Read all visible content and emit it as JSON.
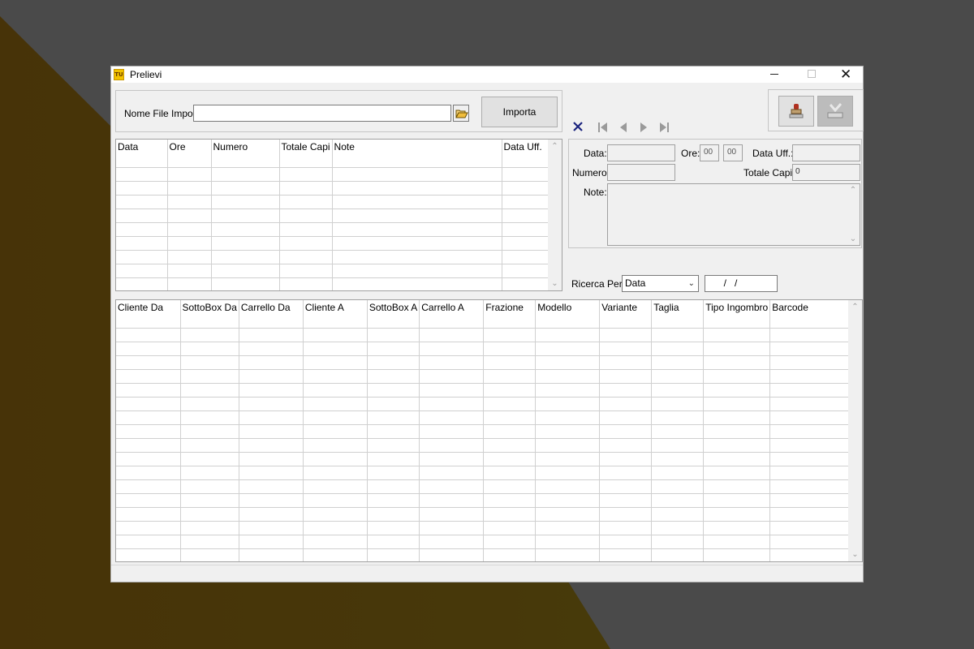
{
  "window": {
    "title": "Prelievi",
    "app_icon_text": "TU"
  },
  "import": {
    "label": "Nome File Import:",
    "value": "",
    "button_label": "Importa"
  },
  "header_table": {
    "columns": [
      "Data",
      "Ore",
      "Numero",
      "Totale Capi",
      "Note",
      "Data Uff."
    ],
    "rows": []
  },
  "detail": {
    "data_label": "Data:",
    "data_value": "",
    "ore_label": "Ore:",
    "ore_hours": "00",
    "ore_minutes": "00",
    "data_uff_label": "Data Uff.:",
    "data_uff_value": "",
    "numero_label": "Numero:",
    "numero_value": "",
    "totale_capi_label": "Totale Capi:",
    "totale_capi_value": "0",
    "note_label": "Note:",
    "note_value": ""
  },
  "search": {
    "label": "Ricerca Per:",
    "selected": "Data",
    "date_value": "  /   /"
  },
  "detail_table": {
    "columns": [
      "Cliente Da",
      "SottoBox Da",
      "Carrello Da",
      "Cliente A",
      "SottoBox A",
      "Carrello A",
      "Frazione",
      "Modello",
      "Variante",
      "Taglia",
      "Tipo Ingombro",
      "Barcode"
    ],
    "rows": []
  },
  "icons": {
    "delete": "close-x-icon",
    "first": "first-record-icon",
    "prev": "prev-record-icon",
    "next": "next-record-icon",
    "last": "last-record-icon",
    "stamp": "stamp-icon",
    "confirm": "confirm-icon",
    "folder": "folder-open-icon"
  },
  "colors": {
    "accent_navy": "#1a237e",
    "desktop": "#4a4a4a",
    "window_bg": "#f0f0f0"
  }
}
